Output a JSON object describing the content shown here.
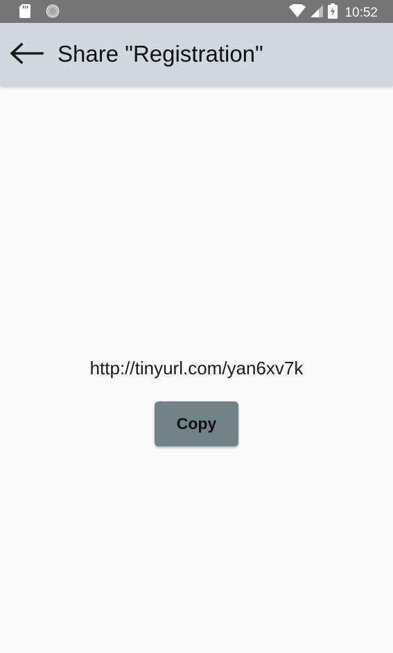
{
  "status_bar": {
    "time": "10:52",
    "icons": [
      "sd-card-icon",
      "circle-notification-icon",
      "wifi-icon",
      "cell-signal-icon",
      "battery-charging-icon"
    ]
  },
  "app_bar": {
    "back_icon": "arrow-left-icon",
    "title": "Share \"Registration\""
  },
  "content": {
    "url": "http://tinyurl.com/yan6xv7k",
    "copy_label": "Copy"
  },
  "colors": {
    "status_bar": "#757575",
    "app_bar": "#cfd8dc",
    "background": "#fafafa",
    "button": "#6e8486"
  }
}
